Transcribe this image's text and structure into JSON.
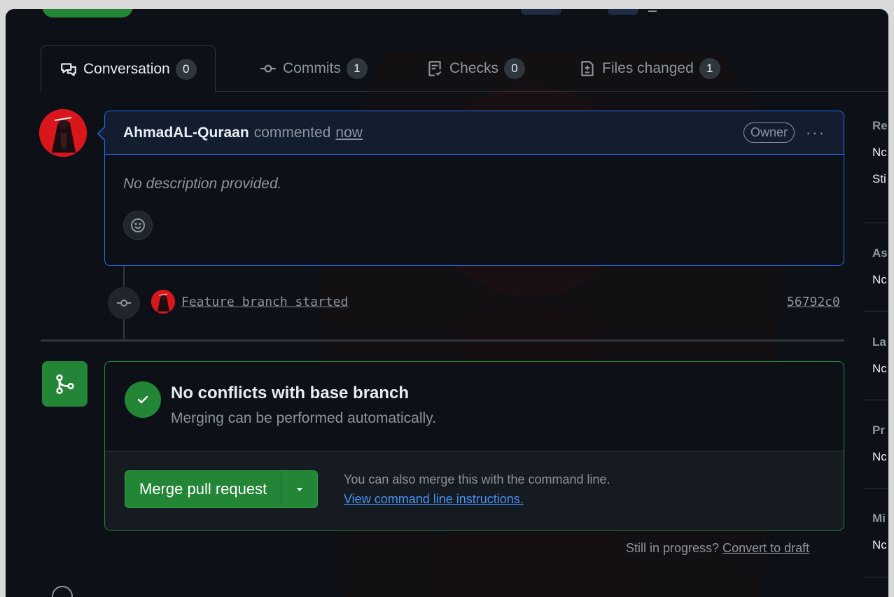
{
  "tabs": [
    {
      "label": "Conversation",
      "count": "0",
      "icon": "comment-discussion-icon",
      "active": true
    },
    {
      "label": "Commits",
      "count": "1",
      "icon": "git-commit-icon",
      "active": false
    },
    {
      "label": "Checks",
      "count": "0",
      "icon": "checklist-icon",
      "active": false
    },
    {
      "label": "Files changed",
      "count": "1",
      "icon": "file-diff-icon",
      "active": false
    }
  ],
  "comment": {
    "author": "AhmadAL-Quraan",
    "action": "commented",
    "time": "now",
    "badge": "Owner",
    "more": "···",
    "description": "No description provided."
  },
  "commit": {
    "message": "Feature branch started",
    "sha": "56792c0"
  },
  "merge": {
    "title": "No conflicts with base branch",
    "subtitle": "Merging can be performed automatically.",
    "button_label": "Merge pull request",
    "hint": "You can also merge this with the command line.",
    "link": "View command line instructions."
  },
  "draft": {
    "prefix": "Still in progress?",
    "link": "Convert to draft"
  },
  "sidebar": [
    {
      "title": "Re",
      "values": [
        "Nc",
        "Sti"
      ]
    },
    {
      "title": "As",
      "values": [
        "Nc"
      ]
    },
    {
      "title": "La",
      "values": [
        "Nc"
      ]
    },
    {
      "title": "Pr",
      "values": [
        "Nc"
      ]
    },
    {
      "title": "Mi",
      "values": [
        "Nc"
      ]
    }
  ],
  "colors": {
    "background": "#0d1117",
    "accent_blue": "#1f6feb",
    "success_green": "#238636",
    "link_blue": "#4493f8",
    "muted_text": "#8b949e"
  }
}
